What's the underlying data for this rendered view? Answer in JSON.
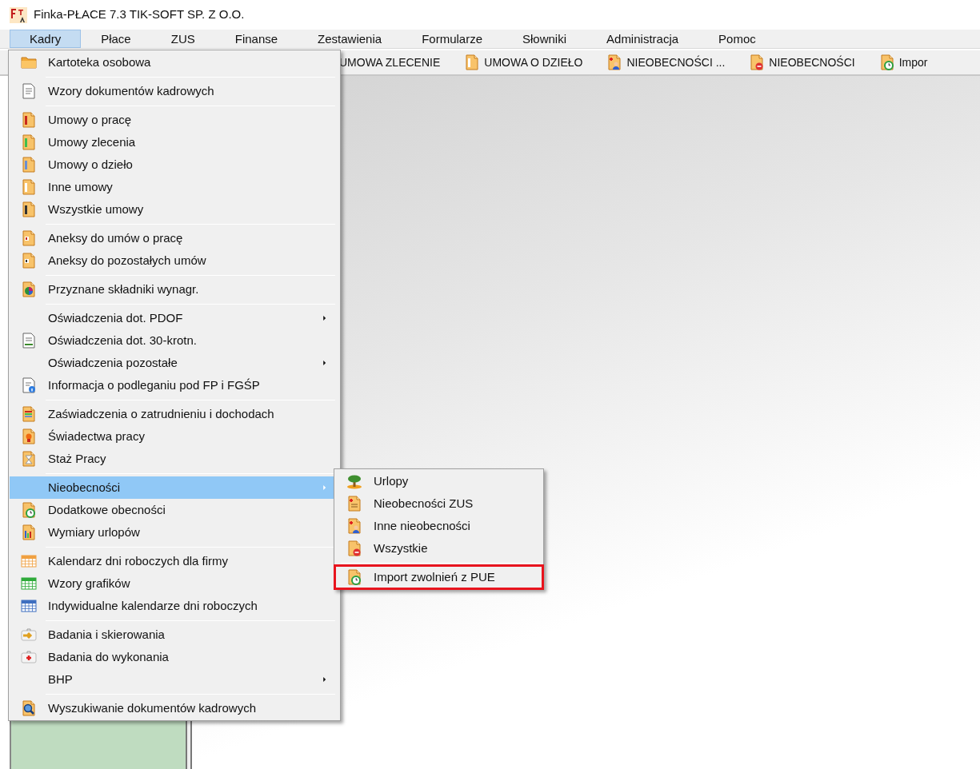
{
  "window": {
    "title": "Finka-PŁACE 7.3 TIK-SOFT SP.  Z O.O."
  },
  "menu_bar": [
    {
      "label": "Kadry",
      "selected": true
    },
    {
      "label": "Płace",
      "selected": false
    },
    {
      "label": "ZUS",
      "selected": false
    },
    {
      "label": "Finanse",
      "selected": false
    },
    {
      "label": "Zestawienia",
      "selected": false
    },
    {
      "label": "Formularze",
      "selected": false
    },
    {
      "label": "Słowniki",
      "selected": false
    },
    {
      "label": "Administracja",
      "selected": false
    },
    {
      "label": "Pomoc",
      "selected": false
    }
  ],
  "toolbar": [
    {
      "label": "UMOWA ZLECENIE"
    },
    {
      "label": "UMOWA O DZIEŁO"
    },
    {
      "label": "NIEOBECNOŚCI ..."
    },
    {
      "label": "NIEOBECNOŚCI"
    },
    {
      "label": "Impor"
    }
  ],
  "dropdown": [
    {
      "kind": "item",
      "label": "Kartoteka osobowa",
      "selected": false,
      "submenu": false
    },
    {
      "kind": "separator"
    },
    {
      "kind": "item",
      "label": "Wzory dokumentów kadrowych",
      "selected": false,
      "submenu": false
    },
    {
      "kind": "separator"
    },
    {
      "kind": "item",
      "label": "Umowy o pracę",
      "selected": false,
      "submenu": false
    },
    {
      "kind": "item",
      "label": "Umowy zlecenia",
      "selected": false,
      "submenu": false
    },
    {
      "kind": "item",
      "label": "Umowy o dzieło",
      "selected": false,
      "submenu": false
    },
    {
      "kind": "item",
      "label": "Inne umowy",
      "selected": false,
      "submenu": false
    },
    {
      "kind": "item",
      "label": "Wszystkie umowy",
      "selected": false,
      "submenu": false
    },
    {
      "kind": "separator"
    },
    {
      "kind": "item",
      "label": "Aneksy do umów o pracę",
      "selected": false,
      "submenu": false
    },
    {
      "kind": "item",
      "label": "Aneksy do pozostałych umów",
      "selected": false,
      "submenu": false
    },
    {
      "kind": "separator"
    },
    {
      "kind": "item",
      "label": "Przyznane składniki wynagr.",
      "selected": false,
      "submenu": false
    },
    {
      "kind": "separator"
    },
    {
      "kind": "item",
      "label": "Oświadczenia dot. PDOF",
      "selected": false,
      "submenu": true
    },
    {
      "kind": "item",
      "label": "Oświadczenia dot. 30-krotn.",
      "selected": false,
      "submenu": false
    },
    {
      "kind": "item",
      "label": "Oświadczenia pozostałe",
      "selected": false,
      "submenu": true
    },
    {
      "kind": "item",
      "label": "Informacja o podleganiu pod FP i FGŚP",
      "selected": false,
      "submenu": false
    },
    {
      "kind": "separator"
    },
    {
      "kind": "item",
      "label": "Zaświadczenia o zatrudnieniu i dochodach",
      "selected": false,
      "submenu": false
    },
    {
      "kind": "item",
      "label": "Świadectwa pracy",
      "selected": false,
      "submenu": false
    },
    {
      "kind": "item",
      "label": "Staż Pracy",
      "selected": false,
      "submenu": false
    },
    {
      "kind": "separator"
    },
    {
      "kind": "item",
      "label": "Nieobecności",
      "selected": true,
      "submenu": true
    },
    {
      "kind": "item",
      "label": "Dodatkowe obecności",
      "selected": false,
      "submenu": false
    },
    {
      "kind": "item",
      "label": "Wymiary urlopów",
      "selected": false,
      "submenu": false
    },
    {
      "kind": "separator"
    },
    {
      "kind": "item",
      "label": "Kalendarz dni roboczych dla firmy",
      "selected": false,
      "submenu": false
    },
    {
      "kind": "item",
      "label": "Wzory grafików",
      "selected": false,
      "submenu": false
    },
    {
      "kind": "item",
      "label": "Indywidualne kalendarze dni roboczych",
      "selected": false,
      "submenu": false
    },
    {
      "kind": "separator"
    },
    {
      "kind": "item",
      "label": "Badania i skierowania",
      "selected": false,
      "submenu": false
    },
    {
      "kind": "item",
      "label": "Badania do wykonania",
      "selected": false,
      "submenu": false
    },
    {
      "kind": "item",
      "label": "BHP",
      "selected": false,
      "submenu": true
    },
    {
      "kind": "separator"
    },
    {
      "kind": "item",
      "label": "Wyszukiwanie dokumentów kadrowych",
      "selected": false,
      "submenu": false
    }
  ],
  "submenu": [
    {
      "kind": "item",
      "label": "Urlopy",
      "highlighted": false
    },
    {
      "kind": "item",
      "label": "Nieobecności ZUS",
      "highlighted": false
    },
    {
      "kind": "item",
      "label": "Inne nieobecności",
      "highlighted": false
    },
    {
      "kind": "item",
      "label": "Wszystkie",
      "highlighted": false
    },
    {
      "kind": "separator"
    },
    {
      "kind": "item",
      "label": "Import zwolnień z PUE",
      "highlighted": true
    }
  ]
}
